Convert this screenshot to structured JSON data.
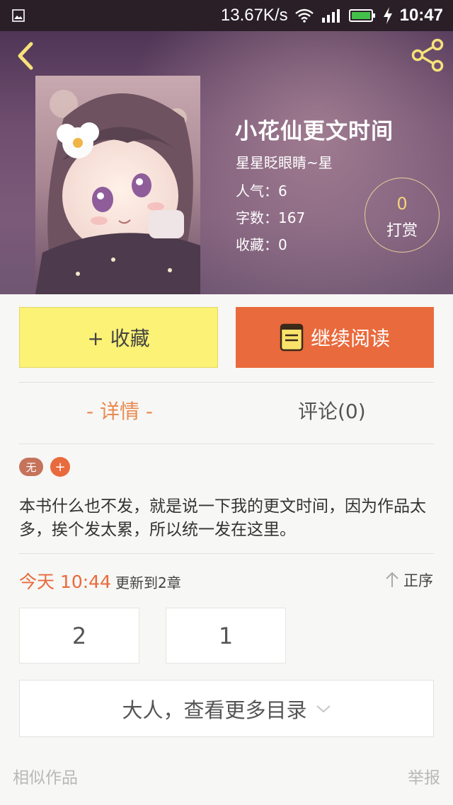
{
  "status_bar": {
    "net_speed": "13.67K/s",
    "time": "10:47",
    "icons": [
      "image-icon",
      "wifi-icon",
      "signal-icon",
      "battery-icon",
      "charging-icon"
    ]
  },
  "header": {
    "back_icon": "chevron-left-icon",
    "share_icon": "share-icon"
  },
  "book": {
    "title": "小花仙更文时间",
    "author": "星星眨眼睛~星",
    "popularity": "人气：6",
    "word_count": "字数：167",
    "favorites": "收藏：0"
  },
  "tip": {
    "count": "0",
    "label": "打赏"
  },
  "actions": {
    "favorite_label": "+ 收藏",
    "read_label": "继续阅读"
  },
  "tabs": {
    "details": "- 详情 -",
    "comments": "评论(0)"
  },
  "tags": {
    "first": "无",
    "add": "+"
  },
  "description": "本书什么也不发，就是说一下我的更文时间，因为作品太多，挨个发太累，所以统一发在这里。",
  "update": {
    "time": "今天 10:44",
    "text": "更新到2章",
    "sort_label": "正序"
  },
  "chapters": [
    "2",
    "1"
  ],
  "more_catalog": "大人，查看更多目录",
  "footer": {
    "similar": "相似作品",
    "report": "举报"
  },
  "colors": {
    "accent": "#e96a3c",
    "favorite_bg": "#fbf276",
    "hero": "#6e4d6f"
  }
}
